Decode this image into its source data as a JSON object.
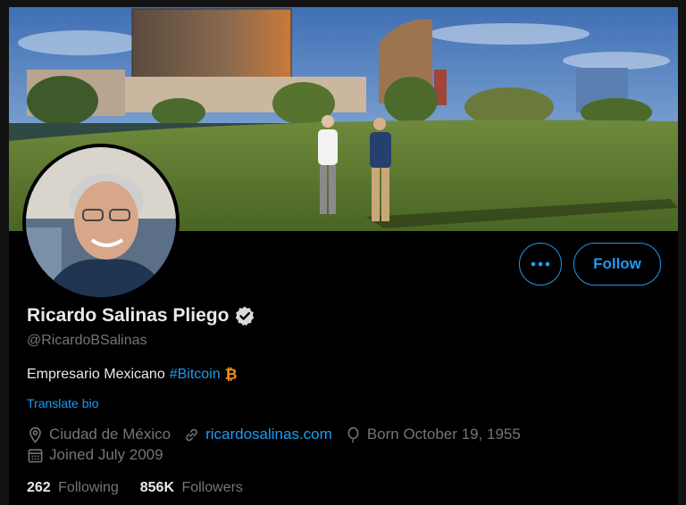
{
  "profile": {
    "display_name": "Ricardo Salinas Pliego",
    "handle": "@RicardoBSalinas",
    "bio_text": "Empresario Mexicano",
    "bio_hashtag": "#Bitcoin",
    "bio_emoji": "₿",
    "translate_label": "Translate bio",
    "location": "Ciudad de México",
    "website": "ricardosalinas.com",
    "birthday": "Born October 19, 1955",
    "joined": "Joined July 2009",
    "following_count": "262",
    "following_label": "Following",
    "followers_count": "856K",
    "followers_label": "Followers"
  },
  "actions": {
    "follow_label": "Follow",
    "more_label": "•••"
  },
  "colors": {
    "accent": "#1d9bf0",
    "background": "#000000",
    "text_primary": "#e7e9ea",
    "text_secondary": "#71767b",
    "bitcoin": "#f7931a"
  },
  "icons": {
    "verified": "verified-badge-icon",
    "location": "location-pin-icon",
    "link": "link-icon",
    "birthday": "balloon-icon",
    "calendar": "calendar-icon",
    "more": "more-dots-icon"
  }
}
